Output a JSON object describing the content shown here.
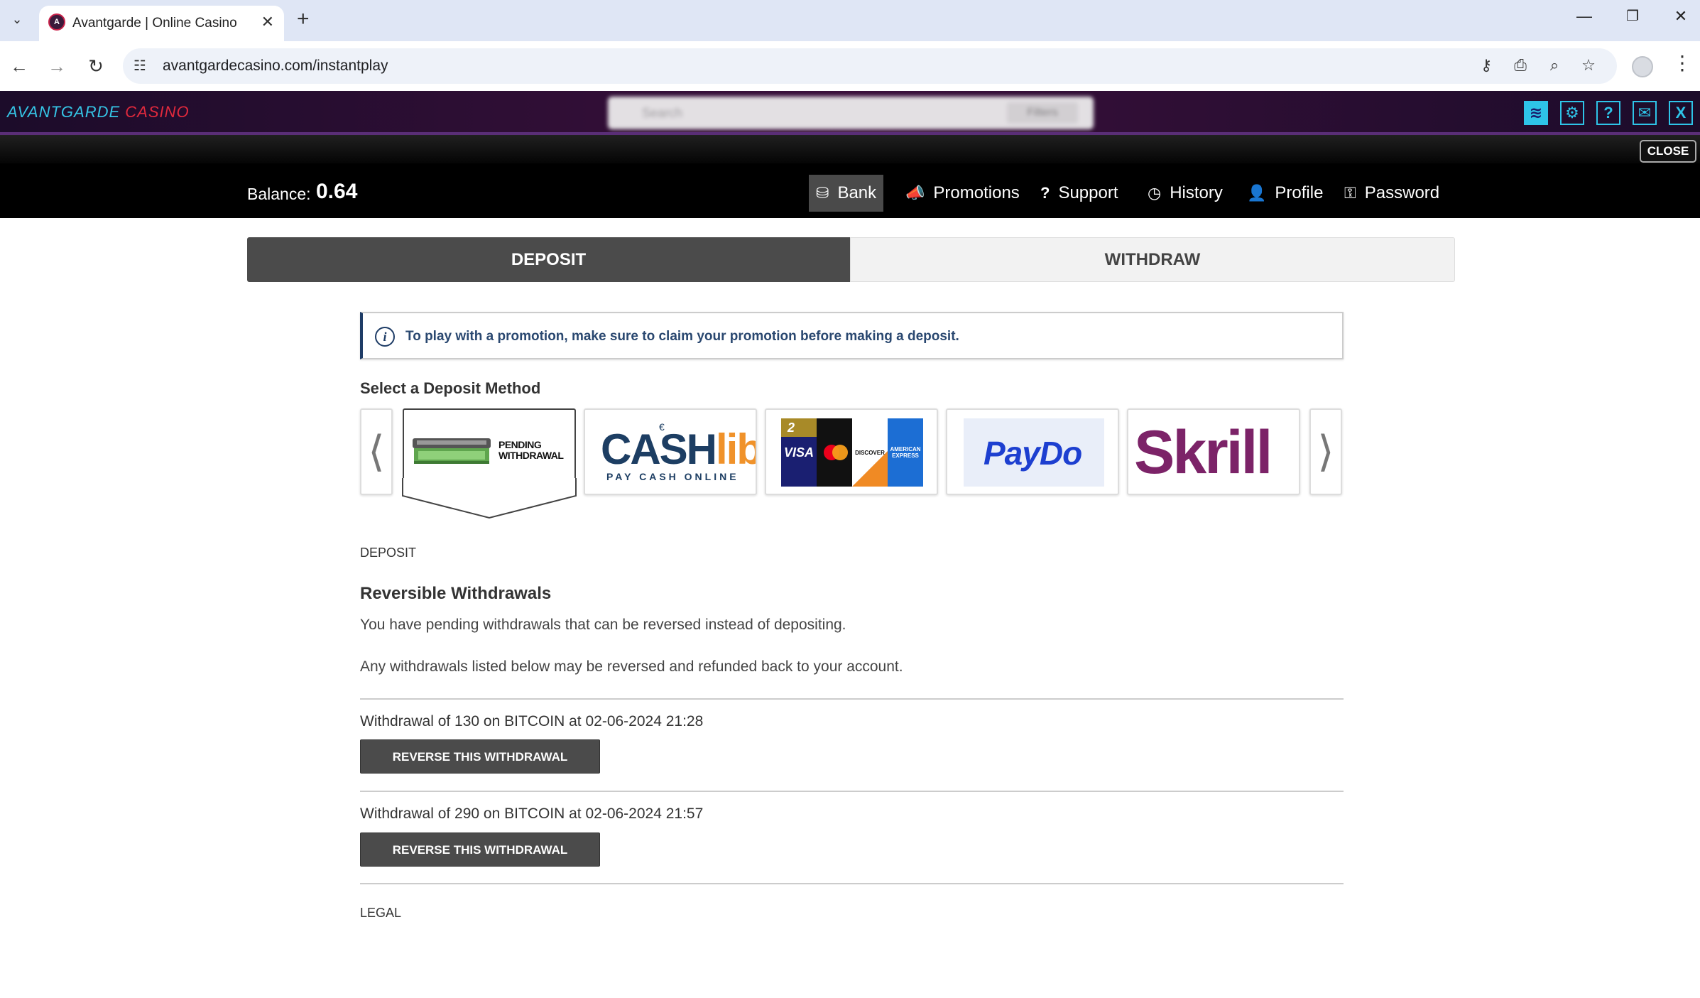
{
  "browser": {
    "tab_title": "Avantgarde | Online Casino",
    "url": "avantgardecasino.com/instantplay",
    "icons": [
      "tab-search-icon",
      "favicon",
      "close-icon",
      "plus-icon",
      "back-icon",
      "forward-icon",
      "reload-icon",
      "site-info-icon",
      "key-icon",
      "install-icon",
      "zoom-icon",
      "star-icon",
      "profile-icon",
      "menu-icon"
    ]
  },
  "casino": {
    "logo_first": "AVANTGARDE",
    "logo_second": "CASINO",
    "search_placeholder": "Search",
    "search_filter": "Filters",
    "close_label": "CLOSE",
    "logo_colors": {
      "first": "#35c5e6",
      "second": "#e0293d"
    }
  },
  "account": {
    "balance_label": "Balance:",
    "balance_value": "0.64"
  },
  "nav": [
    {
      "label": "Bank",
      "icon": "bank-icon",
      "active": true
    },
    {
      "label": "Promotions",
      "icon": "megaphone-icon",
      "active": false
    },
    {
      "label": "Support",
      "icon": "question-icon",
      "active": false
    },
    {
      "label": "History",
      "icon": "history-icon",
      "active": false
    },
    {
      "label": "Profile",
      "icon": "user-icon",
      "active": false
    },
    {
      "label": "Password",
      "icon": "key-icon",
      "active": false
    }
  ],
  "bank_tabs": {
    "deposit": "DEPOSIT",
    "withdraw": "WITHDRAW"
  },
  "info_message": "To play with a promotion, make sure to claim your promotion before making a deposit.",
  "methods": {
    "label": "Select a Deposit Method",
    "pending_withdrawal_line1": "PENDING",
    "pending_withdrawal_line2": "WITHDRAWAL",
    "cashlib_part1": "CASH",
    "cashlib_part2": "lib",
    "cashlib_euro": "€",
    "cashlib_sub": "PAY CASH ONLINE",
    "cards_badge": "2",
    "visa": "VISA",
    "discover": "DISCOVER",
    "amex": "AMERICAN EXPRESS",
    "paydo": "PayDo",
    "skrill": "Skrill"
  },
  "content": {
    "section_heading": "DEPOSIT",
    "title": "Reversible Withdrawals",
    "para1": "You have pending withdrawals that can be reversed instead of depositing.",
    "para2": "Any withdrawals listed below may be reversed and refunded back to your account.",
    "withdrawals": [
      {
        "text": "Withdrawal of 130 on BITCOIN at 02-06-2024 21:28",
        "button": "REVERSE THIS WITHDRAWAL"
      },
      {
        "text": "Withdrawal of 290 on BITCOIN at 02-06-2024 21:57",
        "button": "REVERSE THIS WITHDRAWAL"
      }
    ],
    "legal": "LEGAL"
  }
}
